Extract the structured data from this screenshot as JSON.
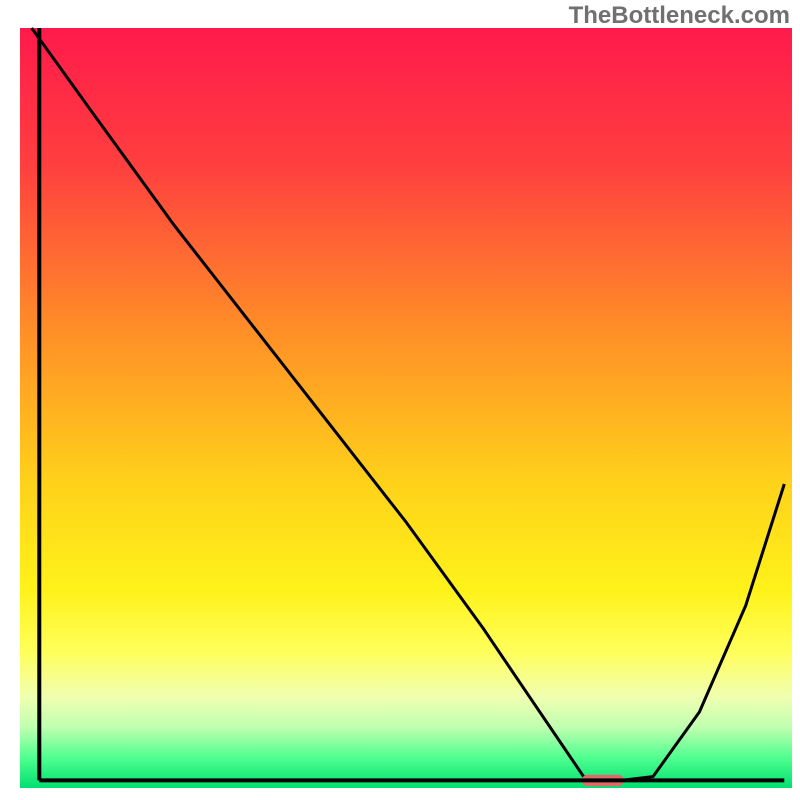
{
  "watermark": "TheBottleneck.com",
  "chart_data": {
    "type": "line",
    "title": "",
    "xlabel": "",
    "ylabel": "",
    "xlim": [
      0,
      100
    ],
    "ylim": [
      0,
      100
    ],
    "gradient_stops": [
      {
        "offset": 0,
        "color": "#ff1a4c"
      },
      {
        "offset": 18,
        "color": "#ff3f3f"
      },
      {
        "offset": 40,
        "color": "#ff8f27"
      },
      {
        "offset": 60,
        "color": "#ffd21a"
      },
      {
        "offset": 74,
        "color": "#fff21a"
      },
      {
        "offset": 82,
        "color": "#ffff5a"
      },
      {
        "offset": 88,
        "color": "#f0ffb0"
      },
      {
        "offset": 92,
        "color": "#c0ffb0"
      },
      {
        "offset": 96,
        "color": "#50ff90"
      },
      {
        "offset": 100,
        "color": "#00e070"
      }
    ],
    "series": [
      {
        "name": "bottleneck-curve",
        "x": [
          1.5,
          10,
          20,
          25,
          30,
          40,
          50,
          60,
          66,
          70,
          73,
          78,
          82,
          88,
          94,
          99
        ],
        "y": [
          100,
          88,
          74,
          67.5,
          61,
          48,
          35,
          21,
          12,
          6,
          1.5,
          1,
          1.5,
          10,
          24,
          40
        ]
      }
    ],
    "marker": {
      "x": 75.5,
      "y": 1,
      "width_pct": 5.5,
      "height_pct": 1.5,
      "color": "#e06a6a",
      "name": "optimal-marker"
    },
    "axes": {
      "left_x": 2.5,
      "bottom_y": 1,
      "right_x": 99,
      "top_y": 100
    }
  }
}
